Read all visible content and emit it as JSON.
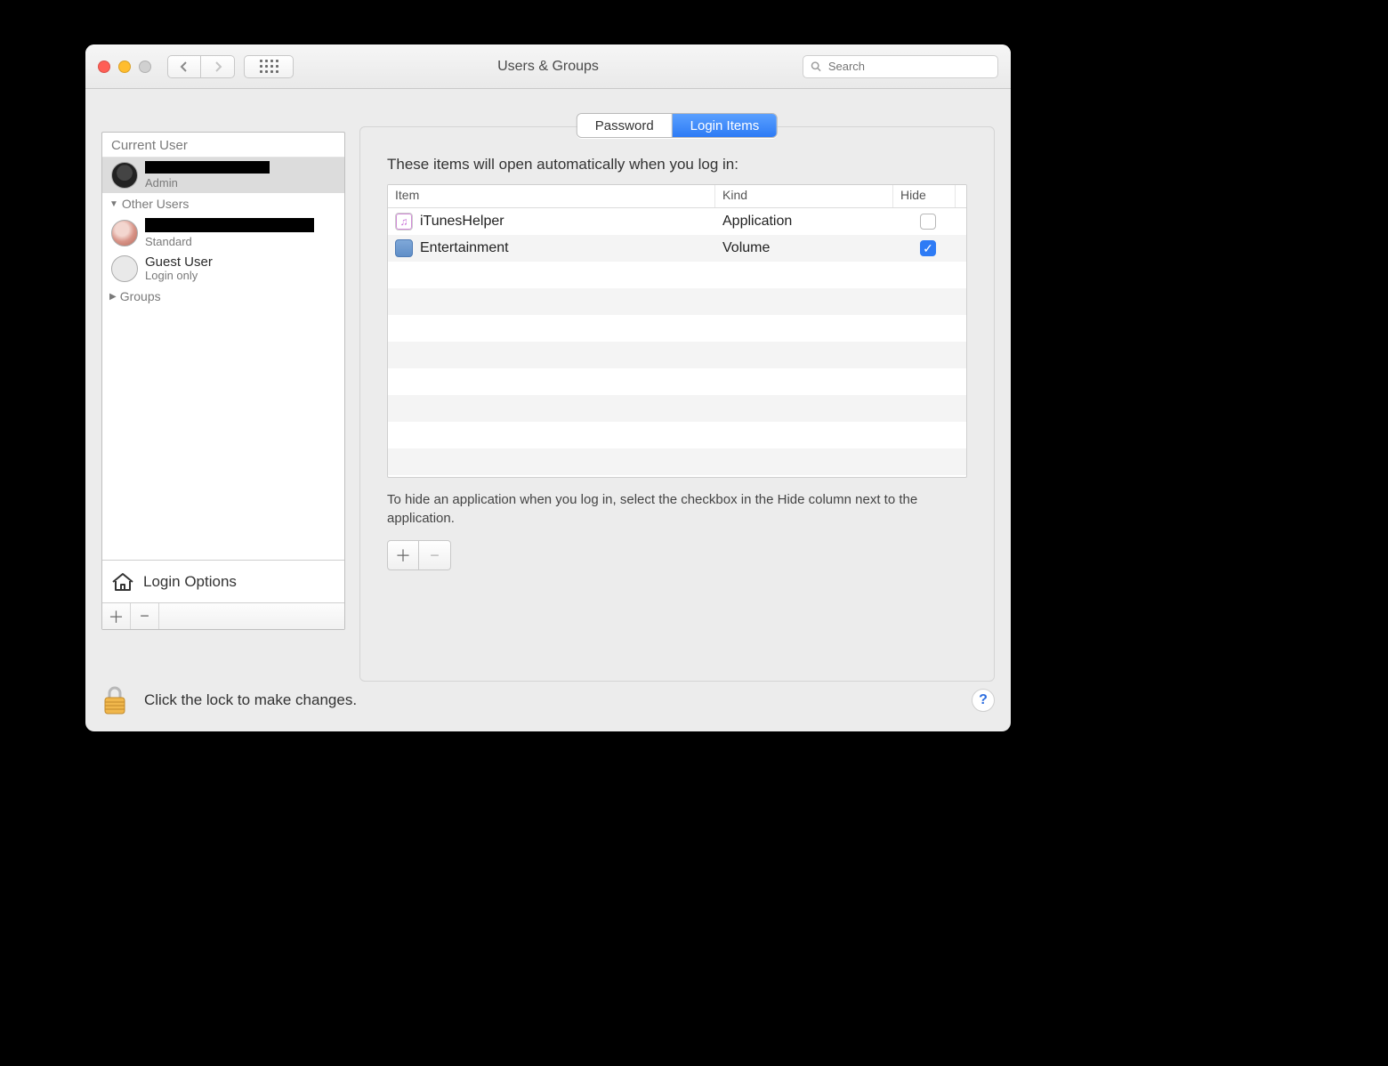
{
  "window": {
    "title": "Users & Groups"
  },
  "search": {
    "placeholder": "Search"
  },
  "sidebar": {
    "current_user_label": "Current User",
    "current_user": {
      "role": "Admin"
    },
    "other_users_label": "Other Users",
    "other": {
      "role": "Standard"
    },
    "guest": {
      "name": "Guest User",
      "role": "Login only"
    },
    "groups_label": "Groups",
    "login_options_label": "Login Options"
  },
  "tabs": {
    "password": "Password",
    "login_items": "Login Items"
  },
  "main": {
    "description": "These items will open automatically when you log in:",
    "columns": {
      "item": "Item",
      "kind": "Kind",
      "hide": "Hide"
    },
    "rows": [
      {
        "name": "iTunesHelper",
        "kind": "Application",
        "hide": false
      },
      {
        "name": "Entertainment",
        "kind": "Volume",
        "hide": true
      }
    ],
    "note": "To hide an application when you log in, select the checkbox in the Hide column next to the application."
  },
  "lock": {
    "text": "Click the lock to make changes."
  },
  "help": {
    "label": "?"
  }
}
